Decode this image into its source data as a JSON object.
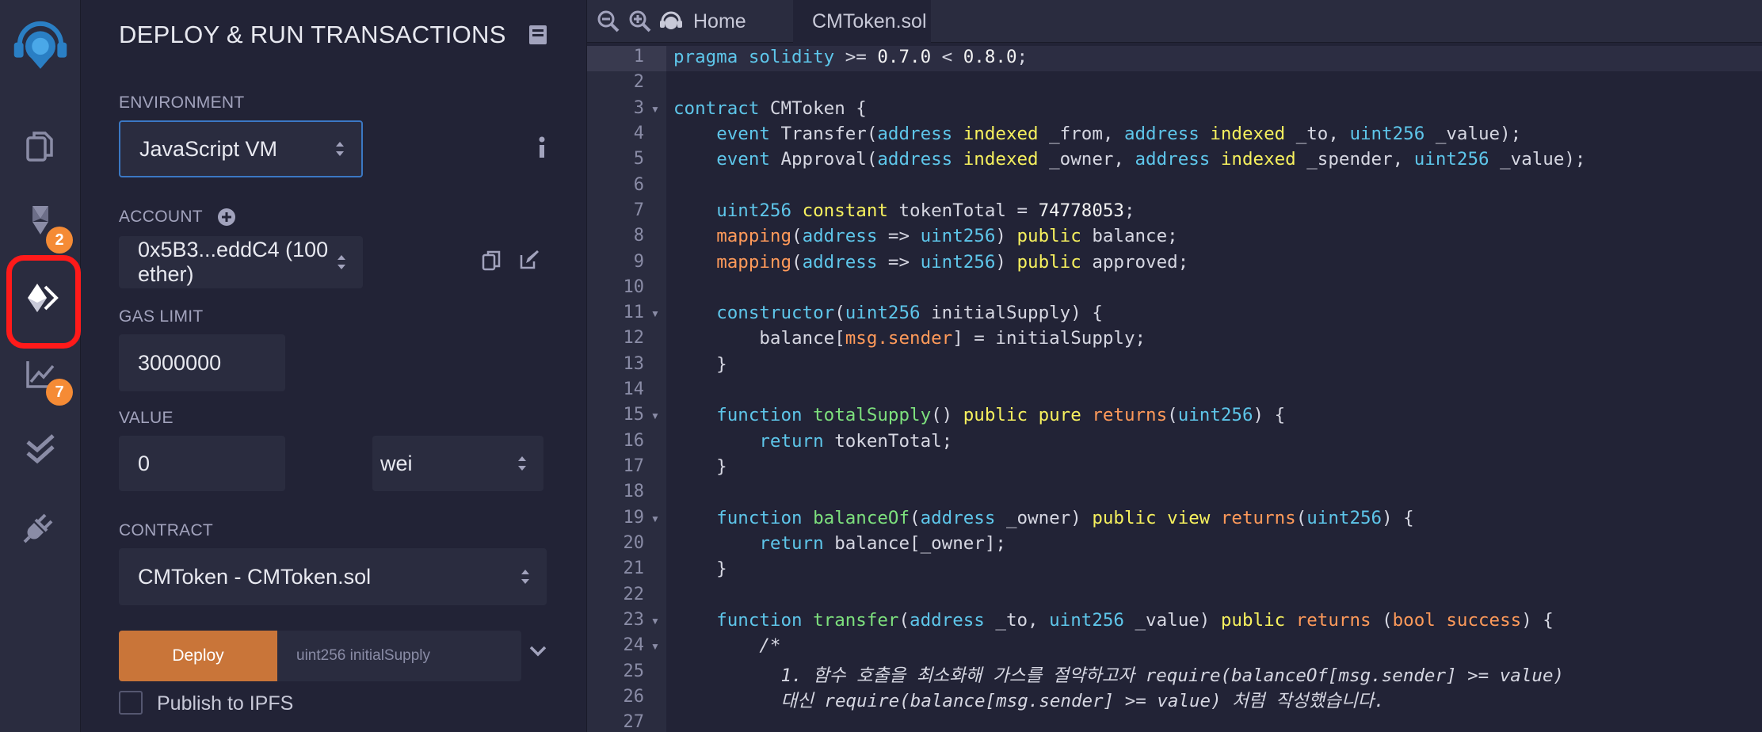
{
  "rail": {
    "badges": {
      "compiler": "2",
      "analysis": "7"
    }
  },
  "panel": {
    "title": "DEPLOY & RUN TRANSACTIONS",
    "environment": {
      "label": "ENVIRONMENT",
      "value": "JavaScript VM"
    },
    "account": {
      "label": "ACCOUNT",
      "value": "0x5B3...eddC4 (100 ether)"
    },
    "gas_limit": {
      "label": "GAS LIMIT",
      "value": "3000000"
    },
    "value": {
      "label": "VALUE",
      "amount": "0",
      "unit": "wei"
    },
    "contract": {
      "label": "CONTRACT",
      "value": "CMToken - CMToken.sol"
    },
    "deploy": {
      "button": "Deploy",
      "arg_placeholder": "uint256 initialSupply"
    },
    "publish": {
      "label": "Publish to IPFS"
    }
  },
  "editor": {
    "tabs": [
      {
        "label": "Home"
      },
      {
        "label": "CMToken.sol"
      }
    ],
    "code_lines": [
      "pragma solidity >= 0.7.0 < 0.8.0;",
      "",
      "contract CMToken {",
      "    event Transfer(address indexed _from, address indexed _to, uint256 _value);",
      "    event Approval(address indexed _owner, address indexed _spender, uint256 _value);",
      "",
      "    uint256 constant tokenTotal = 74778053;",
      "    mapping(address => uint256) public balance;",
      "    mapping(address => uint256) public approved;",
      "",
      "    constructor(uint256 initialSupply) {",
      "        balance[msg.sender] = initialSupply;",
      "    }",
      "",
      "    function totalSupply() public pure returns(uint256) {",
      "        return tokenTotal;",
      "    }",
      "",
      "    function balanceOf(address _owner) public view returns(uint256) {",
      "        return balance[_owner];",
      "    }",
      "",
      "    function transfer(address _to, uint256 _value) public returns (bool success) {",
      "        /*",
      "          1. 함수 호출을 최소화해 가스를 절약하고자 require(balanceOf[msg.sender] >= value)",
      "          대신 require(balance[msg.sender] >= value) 처럼 작성했습니다.",
      ""
    ]
  }
}
